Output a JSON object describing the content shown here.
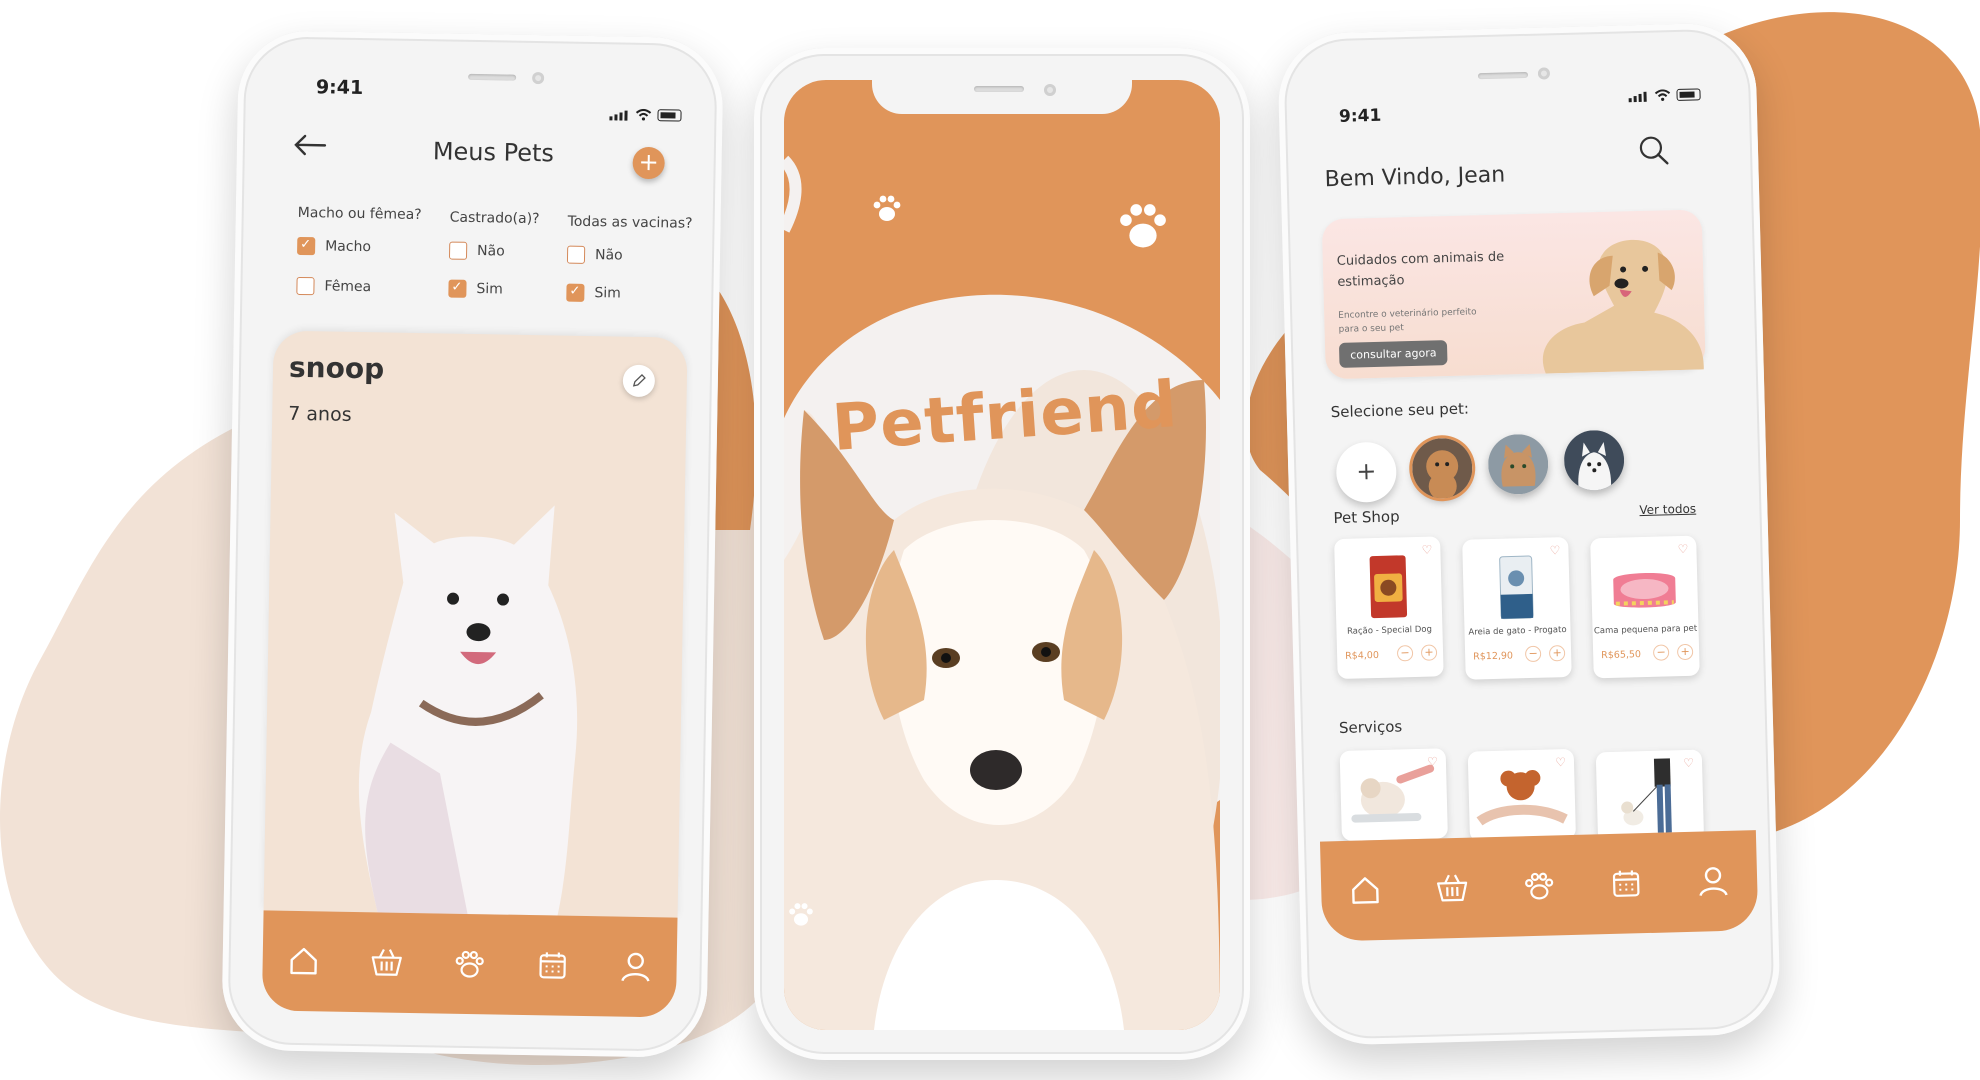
{
  "colors": {
    "accent": "#e0955a",
    "blob_light": "#f2e2d6",
    "blob_pink": "#fbecea",
    "white": "#ffffff"
  },
  "phone1": {
    "status": {
      "time": "9:41"
    },
    "header": {
      "title": "Meus Pets",
      "back_icon": "arrow-left-icon",
      "add_label": "+"
    },
    "filters": [
      {
        "label": "Macho ou fêmea?",
        "options": [
          {
            "label": "Macho",
            "checked": true
          },
          {
            "label": "Fêmea",
            "checked": false
          }
        ]
      },
      {
        "label": "Castrado(a)?",
        "options": [
          {
            "label": "Não",
            "checked": false
          },
          {
            "label": "Sim",
            "checked": true
          }
        ]
      },
      {
        "label": "Todas as vacinas?",
        "options": [
          {
            "label": "Não",
            "checked": false
          },
          {
            "label": "Sim",
            "checked": true
          }
        ]
      }
    ],
    "pet": {
      "name": "snoop",
      "age": "7 anos",
      "edit_icon": "pencil-icon"
    },
    "tabs": [
      "home-icon",
      "basket-icon",
      "paw-icon",
      "calendar-icon",
      "user-icon"
    ]
  },
  "phone2": {
    "brand": "Petfriend",
    "icons": [
      "paw-icon",
      "paw-icon",
      "paw-icon"
    ]
  },
  "phone3": {
    "status": {
      "time": "9:41"
    },
    "greeting": "Bem Vindo, Jean",
    "banner": {
      "title": "Cuidados com animais de estimação",
      "subtitle": "Encontre o veterinário perfeito para o seu pet",
      "button": "consultar agora"
    },
    "select_pet_label": "Selecione seu pet:",
    "add_pet_label": "+",
    "petshop_label": "Pet Shop",
    "see_all": "Ver todos",
    "products": [
      {
        "name": "Ração - Special Dog",
        "price": "R$4,00"
      },
      {
        "name": "Areia de gato - Progato",
        "price": "R$12,90"
      },
      {
        "name": "Cama pequena para pet",
        "price": "R$65,50"
      }
    ],
    "qty": {
      "minus": "−",
      "plus": "+"
    },
    "services_label": "Serviços",
    "tabs": [
      "home-icon",
      "basket-icon",
      "paw-icon",
      "calendar-icon",
      "user-icon"
    ]
  }
}
